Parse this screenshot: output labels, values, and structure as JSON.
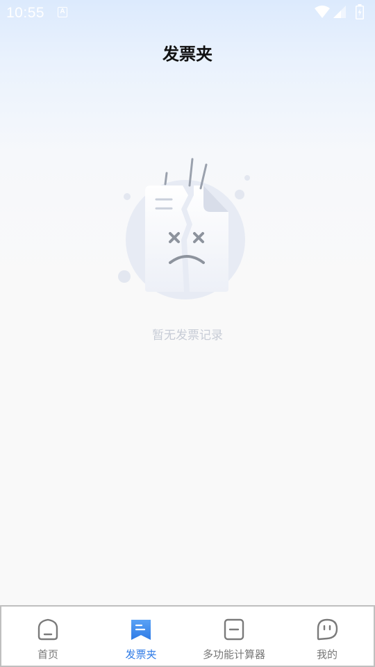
{
  "status_bar": {
    "time": "10:55",
    "notification_icon": "A"
  },
  "header": {
    "title": "发票夹"
  },
  "empty_state": {
    "icon": "sad-broken-document-icon",
    "message": "暂无发票记录"
  },
  "bottom_nav": {
    "items": [
      {
        "label": "首页",
        "icon": "home-icon",
        "active": false
      },
      {
        "label": "发票夹",
        "icon": "invoice-folder-icon",
        "active": true
      },
      {
        "label": "多功能计算器",
        "icon": "calculator-icon",
        "active": false
      },
      {
        "label": "我的",
        "icon": "profile-face-icon",
        "active": false
      }
    ],
    "active_color": "#2f7be6",
    "inactive_color": "#777777"
  }
}
